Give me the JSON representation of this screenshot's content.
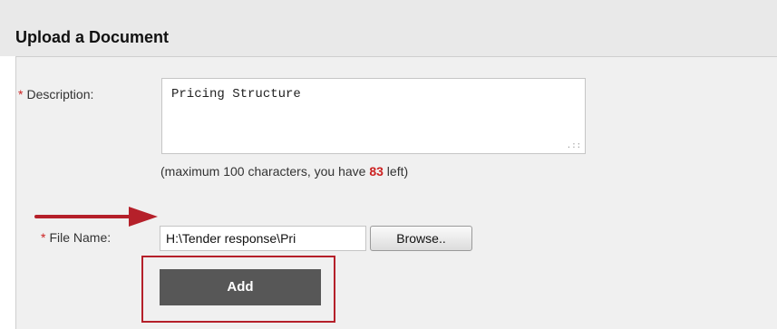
{
  "page": {
    "title": "Upload a Document"
  },
  "form": {
    "required_marker": "*",
    "description": {
      "label": "Description:",
      "value": "Pricing Structure",
      "resize_grip": ".::"
    },
    "hint": {
      "prefix": "(maximum 100 characters, you have ",
      "remaining": "83",
      "suffix": " left)"
    },
    "file": {
      "label": "File Name:",
      "value": "H:\\Tender response\\Pri",
      "browse_label": "Browse.."
    },
    "add_label": "Add"
  },
  "colors": {
    "required": "#cc2222",
    "annotation": "#b5202a",
    "add_button": "#575757"
  },
  "annotations": {
    "arrow_icon": "right-arrow-icon",
    "highlight": "red-box"
  }
}
